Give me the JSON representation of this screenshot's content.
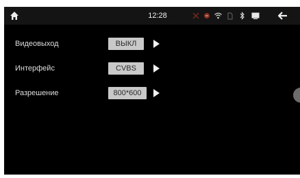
{
  "statusbar": {
    "time": "12:28",
    "icons": [
      "home-icon",
      "no-usb-icon",
      "phone-missed-icon",
      "wifi-icon",
      "sim-icon",
      "bluetooth-icon",
      "window-icon",
      "back-icon"
    ]
  },
  "settings": [
    {
      "label": "Видеовыход",
      "value": "ВЫКЛ"
    },
    {
      "label": "Интерфейс",
      "value": "CVBS"
    },
    {
      "label": "Разрешение",
      "value": "800*600"
    }
  ]
}
